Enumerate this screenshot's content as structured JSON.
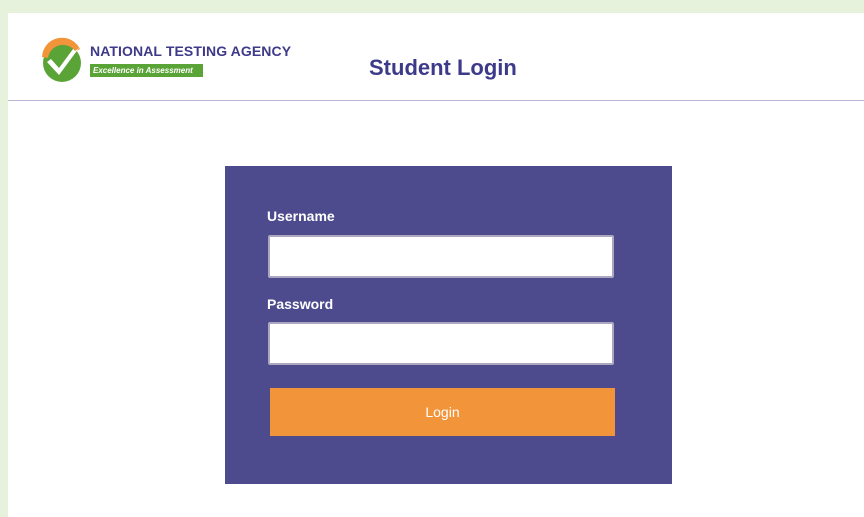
{
  "brand": {
    "name": "NATIONAL TESTING AGENCY",
    "tagline": "Excellence in Assessment",
    "logo_icon": "nta-checkmark-logo-icon",
    "colors": {
      "primary": "#3e3a8a",
      "green": "#5aa437",
      "orange": "#f2943a"
    }
  },
  "header": {
    "title": "Student Login"
  },
  "login_form": {
    "background": "#4d4b8d",
    "username": {
      "label": "Username",
      "value": "",
      "placeholder": ""
    },
    "password": {
      "label": "Password",
      "value": "",
      "placeholder": ""
    },
    "submit_label": "Login"
  }
}
